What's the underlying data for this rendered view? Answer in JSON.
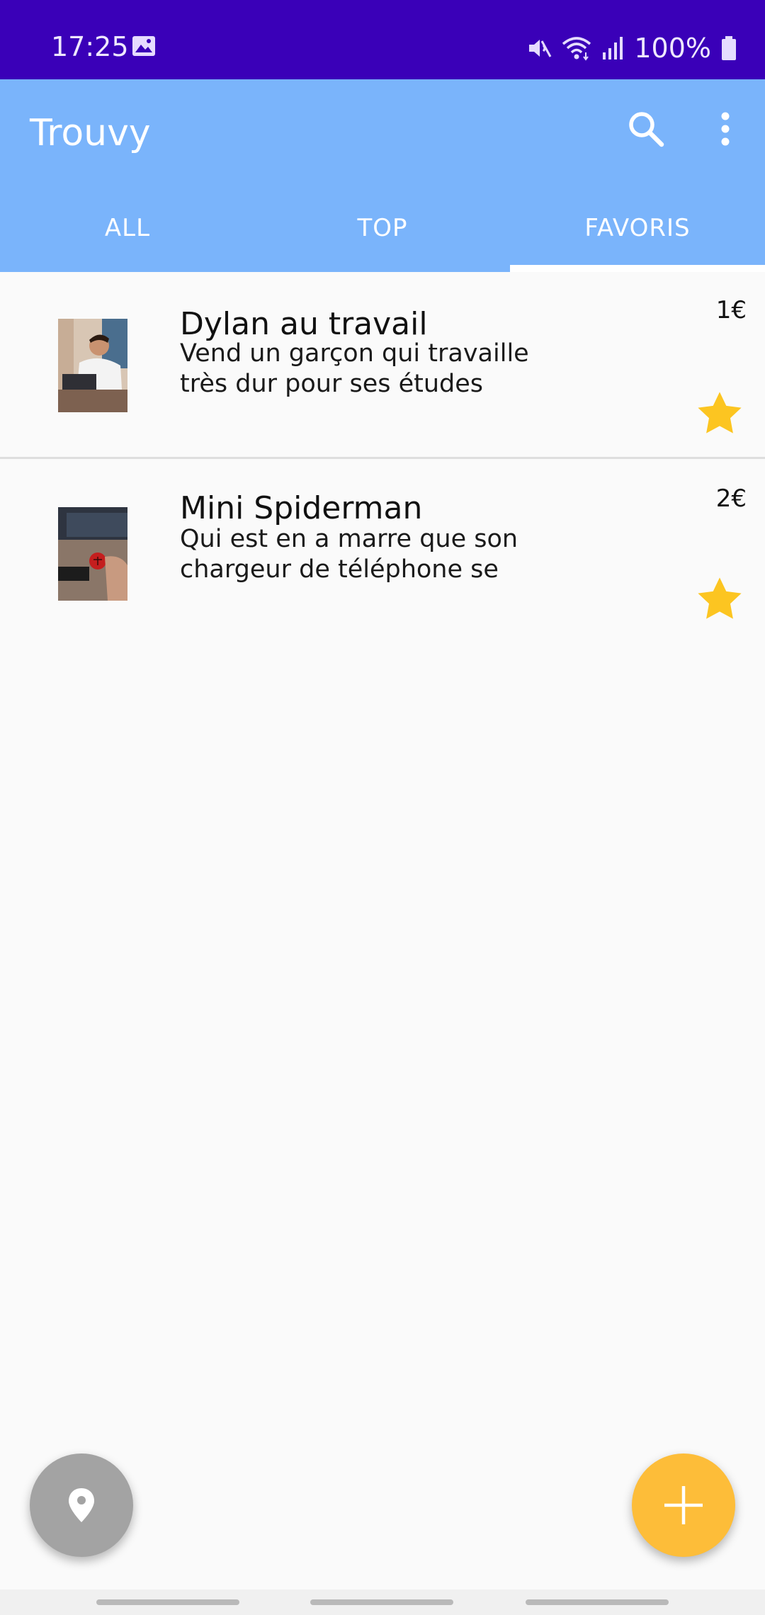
{
  "status_bar": {
    "time": "17:25",
    "battery": "100%",
    "icons": [
      "gallery-icon",
      "mute-icon",
      "wifi-icon",
      "signal-icon",
      "battery-icon"
    ]
  },
  "app_bar": {
    "title": "Trouvy",
    "background": "#7ab4fb",
    "icons": [
      "search-icon",
      "more-vert-icon"
    ]
  },
  "tabs": [
    {
      "label": "ALL",
      "active": false
    },
    {
      "label": "TOP",
      "active": false
    },
    {
      "label": "FAVORIS",
      "active": true
    }
  ],
  "items": [
    {
      "title": "Dylan au travail",
      "description": "Vend un garçon qui travaille très dur pour ses études",
      "price": "1€",
      "favorite": true
    },
    {
      "title": "Mini Spiderman",
      "description": "Qui est en a marre que son chargeur de téléphone se",
      "price": "2€",
      "favorite": true
    }
  ],
  "fabs": {
    "location": {
      "icon": "location-pin-icon",
      "color": "#a3a3a3"
    },
    "add": {
      "icon": "plus-icon",
      "color": "#fdbd39"
    }
  },
  "colors": {
    "status_bar": "#3a00b8",
    "accent_star": "#fcc521"
  }
}
